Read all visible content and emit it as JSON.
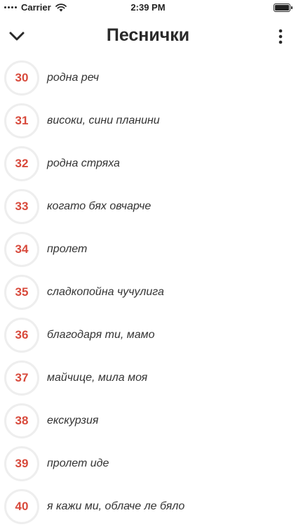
{
  "status_bar": {
    "carrier": "Carrier",
    "time": "2:39 PM",
    "battery_level": 1.0
  },
  "nav": {
    "title": "Песнички",
    "back_icon": "chevron-down-icon",
    "menu_icon": "more-vertical-icon"
  },
  "colors": {
    "accent": "#d84a3c",
    "circle_border": "#eeeeee"
  },
  "songs": [
    {
      "number": "30",
      "title": "родна реч"
    },
    {
      "number": "31",
      "title": "високи, сини планини"
    },
    {
      "number": "32",
      "title": "родна стряха"
    },
    {
      "number": "33",
      "title": "когато бях овчарче"
    },
    {
      "number": "34",
      "title": "пролет"
    },
    {
      "number": "35",
      "title": "сладкопойна чучулига"
    },
    {
      "number": "36",
      "title": "благодаря ти, мамо"
    },
    {
      "number": "37",
      "title": "майчице, мила моя"
    },
    {
      "number": "38",
      "title": "екскурзия"
    },
    {
      "number": "39",
      "title": "пролет иде"
    },
    {
      "number": "40",
      "title": "я кажи ми, облаче ле бяло"
    }
  ]
}
